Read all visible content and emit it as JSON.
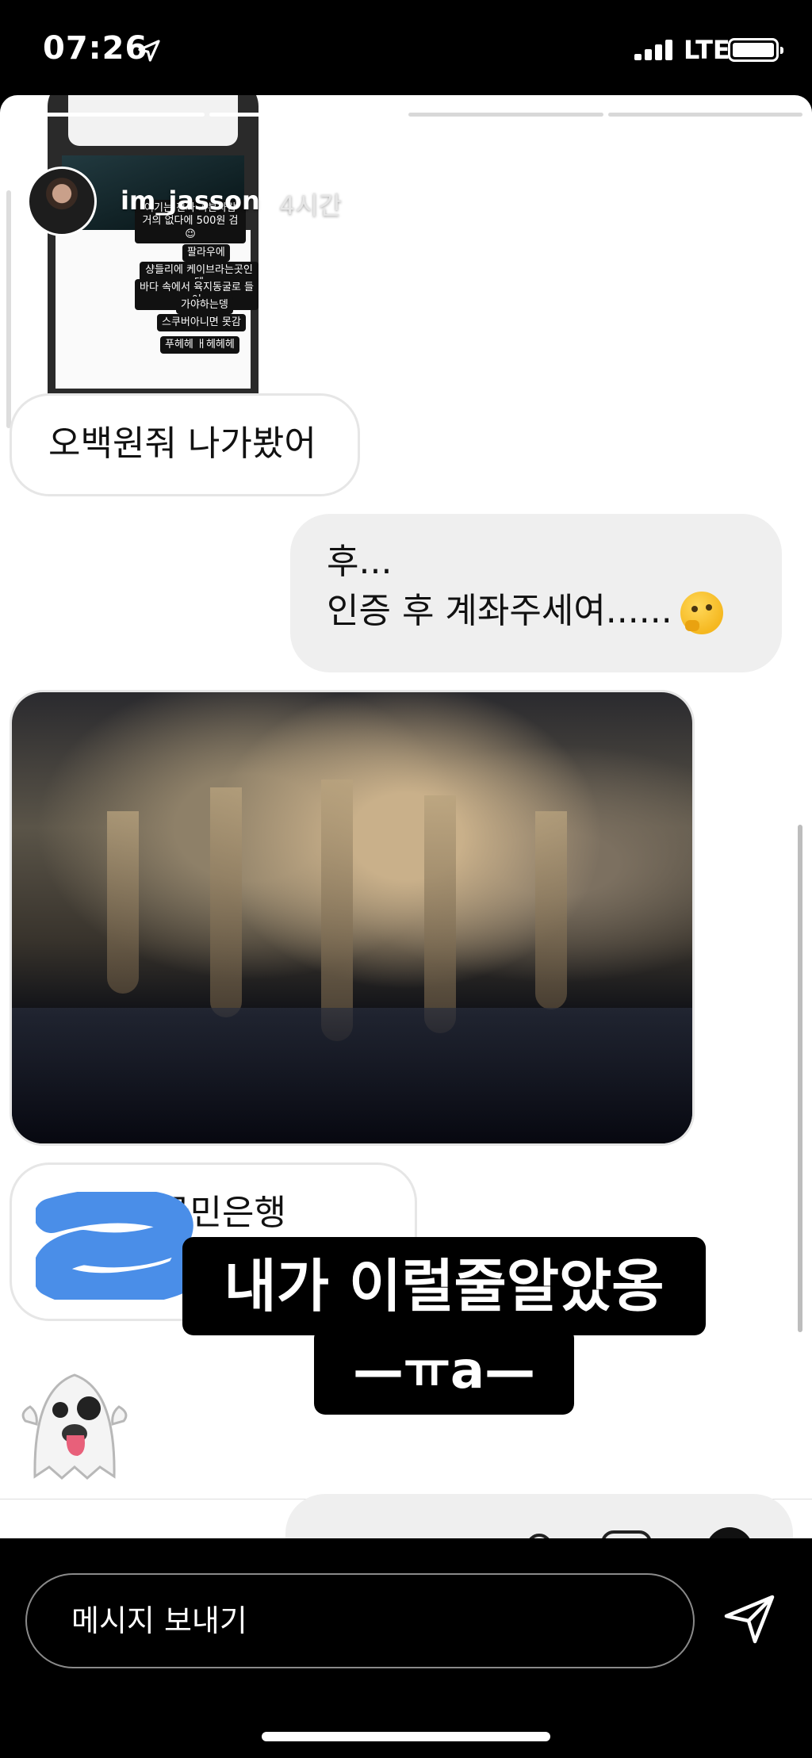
{
  "status_bar": {
    "time": "07:26",
    "network": "LTE"
  },
  "story": {
    "username": "im_jasson",
    "time_ago": "4시간",
    "progress_segments": 4,
    "progress_done": 2
  },
  "embedded_screenshot": {
    "captions": [
      "여기는 진짜 가본사람 거의 없다에 500원 검😉",
      "팔라우에",
      "샹들리에 케이브라는곳인뎅",
      "바다 속에서 육지동굴로 들어",
      "가야하는뎅",
      "스쿠버아니면 못감",
      "푸헤헤 ㅐ헤헤헤"
    ]
  },
  "messages": [
    {
      "direction": "in",
      "text": "오백원줘 나가봤어"
    },
    {
      "direction": "out",
      "lines": [
        "후...",
        "인증 후 계좌주세여......"
      ],
      "emoji": "thinking-face"
    },
    {
      "direction": "in",
      "type": "photo",
      "description": "cave"
    },
    {
      "direction": "in",
      "text": "국민은행",
      "redacted": true
    },
    {
      "direction": "in",
      "type": "emoji",
      "emoji": "ghost"
    }
  ],
  "story_overlay": {
    "line1": "내가 이럴줄알았옹",
    "line2": "—ㅠa—"
  },
  "reply": {
    "placeholder": "메시지 보내기"
  }
}
